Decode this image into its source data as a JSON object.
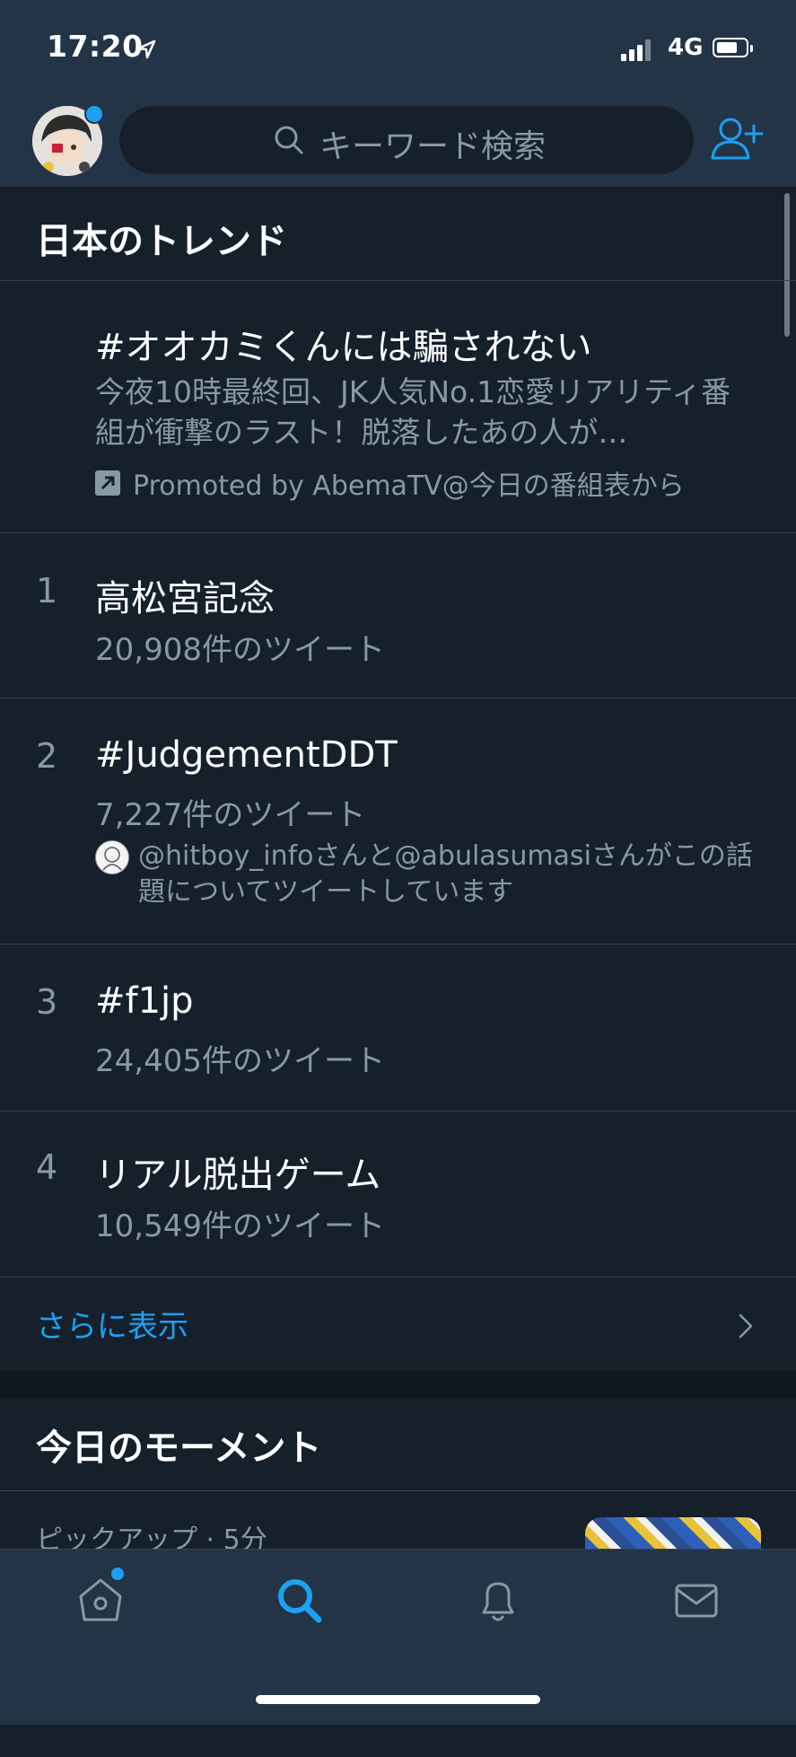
{
  "status_bar": {
    "time": "17:20",
    "network": "4G"
  },
  "search": {
    "placeholder": "キーワード検索"
  },
  "trends": {
    "title": "日本のトレンド",
    "promoted": {
      "name": "#オオカミくんには騙されない",
      "description": "今夜10時最終回、JK人気No.1恋愛リアリティ番組が衝撃のラスト！脱落したあの人が…",
      "promoted_by": "Promoted by AbemaTV@今日の番組表から"
    },
    "items": [
      {
        "rank": "1",
        "name": "高松宮記念",
        "count": "20,908件のツイート"
      },
      {
        "rank": "2",
        "name": "#JudgementDDT",
        "count": "7,227件のツイート",
        "context": "@hitboy_infoさんと@abulasumasiさんがこの話題についてツイートしています"
      },
      {
        "rank": "3",
        "name": "#f1jp",
        "count": "24,405件のツイート"
      },
      {
        "rank": "4",
        "name": "リアル脱出ゲーム",
        "count": "10,549件のツイート"
      }
    ],
    "show_more": "さらに表示"
  },
  "moments": {
    "title": "今日のモーメント",
    "meta": "ピックアップ · 5分"
  },
  "tabs": [
    "home-icon",
    "search-icon",
    "notifications-icon",
    "messages-icon"
  ],
  "colors": {
    "accent": "#1da1f2",
    "background": "#15202b",
    "header": "#243447",
    "secondary_text": "#8899a6"
  }
}
